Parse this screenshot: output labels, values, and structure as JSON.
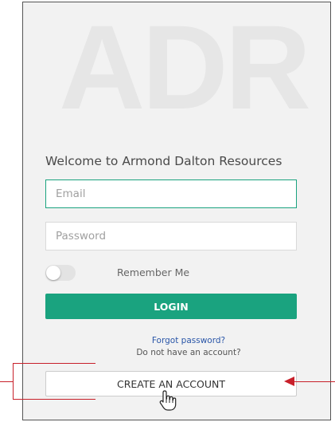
{
  "watermark": {
    "text": "ADR"
  },
  "login_form": {
    "title": "Welcome to Armond Dalton Resources",
    "email": {
      "placeholder": "Email",
      "value": ""
    },
    "password": {
      "placeholder": "Password",
      "value": ""
    },
    "remember_me": {
      "label": "Remember Me",
      "checked": false
    },
    "login_label": "LOGIN",
    "forgot_password": "Forgot password?",
    "no_account": "Do not have an account?",
    "create_account_label": "CREATE AN ACCOUNT"
  },
  "colors": {
    "accent": "#1aa37f",
    "link": "#2a56a8",
    "annotation": "#c8202a"
  },
  "icons": {
    "cursor": "hand-pointer-icon",
    "arrow": "arrow-left-icon"
  }
}
